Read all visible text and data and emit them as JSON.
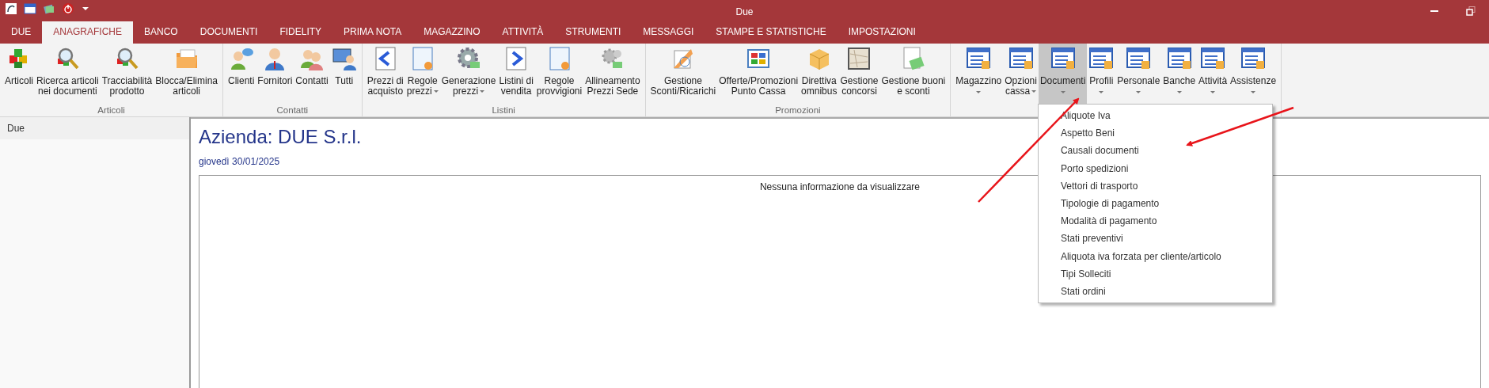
{
  "window": {
    "title": "Due"
  },
  "tabs": [
    {
      "label": "DUE",
      "selected": false
    },
    {
      "label": "ANAGRAFICHE",
      "selected": true
    },
    {
      "label": "BANCO",
      "selected": false
    },
    {
      "label": "DOCUMENTI",
      "selected": false
    },
    {
      "label": "FIDELITY",
      "selected": false
    },
    {
      "label": "PRIMA NOTA",
      "selected": false
    },
    {
      "label": "MAGAZZINO",
      "selected": false
    },
    {
      "label": "ATTIVITÀ",
      "selected": false
    },
    {
      "label": "STRUMENTI",
      "selected": false
    },
    {
      "label": "MESSAGGI",
      "selected": false
    },
    {
      "label": "STAMPE E STATISTICHE",
      "selected": false
    },
    {
      "label": "IMPOSTAZIONI",
      "selected": false
    }
  ],
  "ribbon_groups": [
    {
      "label": "Articoli",
      "buttons": [
        {
          "label": "Articoli",
          "selected": false
        },
        {
          "label": "Ricerca articoli nei documenti",
          "selected": false
        },
        {
          "label": "Tracciabilità prodotto",
          "selected": false
        },
        {
          "label": "Blocca/Elimina articoli",
          "selected": false
        }
      ]
    },
    {
      "label": "Contatti",
      "buttons": [
        {
          "label": "Clienti",
          "selected": false
        },
        {
          "label": "Fornitori",
          "selected": false
        },
        {
          "label": "Contatti",
          "selected": false
        },
        {
          "label": "Tutti",
          "selected": false
        }
      ]
    },
    {
      "label": "Listini",
      "buttons": [
        {
          "label": "Prezzi di acquisto",
          "selected": false
        },
        {
          "label": "Regole prezzi",
          "selected": false,
          "dropdown": true
        },
        {
          "label": "Generazione prezzi",
          "selected": false,
          "dropdown": true
        },
        {
          "label": "Listini di vendita",
          "selected": false
        },
        {
          "label": "Regole provvigioni",
          "selected": false
        },
        {
          "label": "Allineamento Prezzi Sede",
          "selected": false
        }
      ]
    },
    {
      "label": "Promozioni",
      "buttons": [
        {
          "label": "Gestione Sconti/Ricarichi",
          "selected": false
        },
        {
          "label": "Offerte/Promozioni Punto Cassa",
          "selected": false
        },
        {
          "label": "Direttiva omnibus",
          "selected": false
        },
        {
          "label": "Gestione concorsi",
          "selected": false
        },
        {
          "label": "Gestione buoni e sconti",
          "selected": false
        }
      ]
    },
    {
      "buttons": [
        {
          "label": "Magazzino",
          "selected": false,
          "dropdown": true
        },
        {
          "label": "Opzioni cassa",
          "selected": false,
          "dropdown": true
        },
        {
          "label": "Documenti",
          "selected": true,
          "dropdown": true
        },
        {
          "label": "Profili",
          "selected": false,
          "dropdown": true
        },
        {
          "label": "Personale",
          "selected": false,
          "dropdown": true
        },
        {
          "label": "Banche",
          "selected": false,
          "dropdown": true
        },
        {
          "label": "Attività",
          "selected": false,
          "dropdown": true
        },
        {
          "label": "Assistenze",
          "selected": false,
          "dropdown": true
        }
      ]
    }
  ],
  "dropdown_menu": {
    "items": [
      "Aliquote Iva",
      "Aspetto Beni",
      "Causali documenti",
      "Porto spedizioni",
      "Vettori di trasporto",
      "Tipologie di pagamento",
      "Modalità di pagamento",
      "Stati preventivi",
      "Aliquota iva forzata per cliente/articolo",
      "Tipi Solleciti",
      "Stati ordini"
    ]
  },
  "sidebar": {
    "items": [
      {
        "label": "Due",
        "selected": true
      }
    ]
  },
  "main": {
    "heading": "Azienda: DUE S.r.l.",
    "date": "giovedì 30/01/2025",
    "message": "Nessuna informazione da visualizzare"
  }
}
